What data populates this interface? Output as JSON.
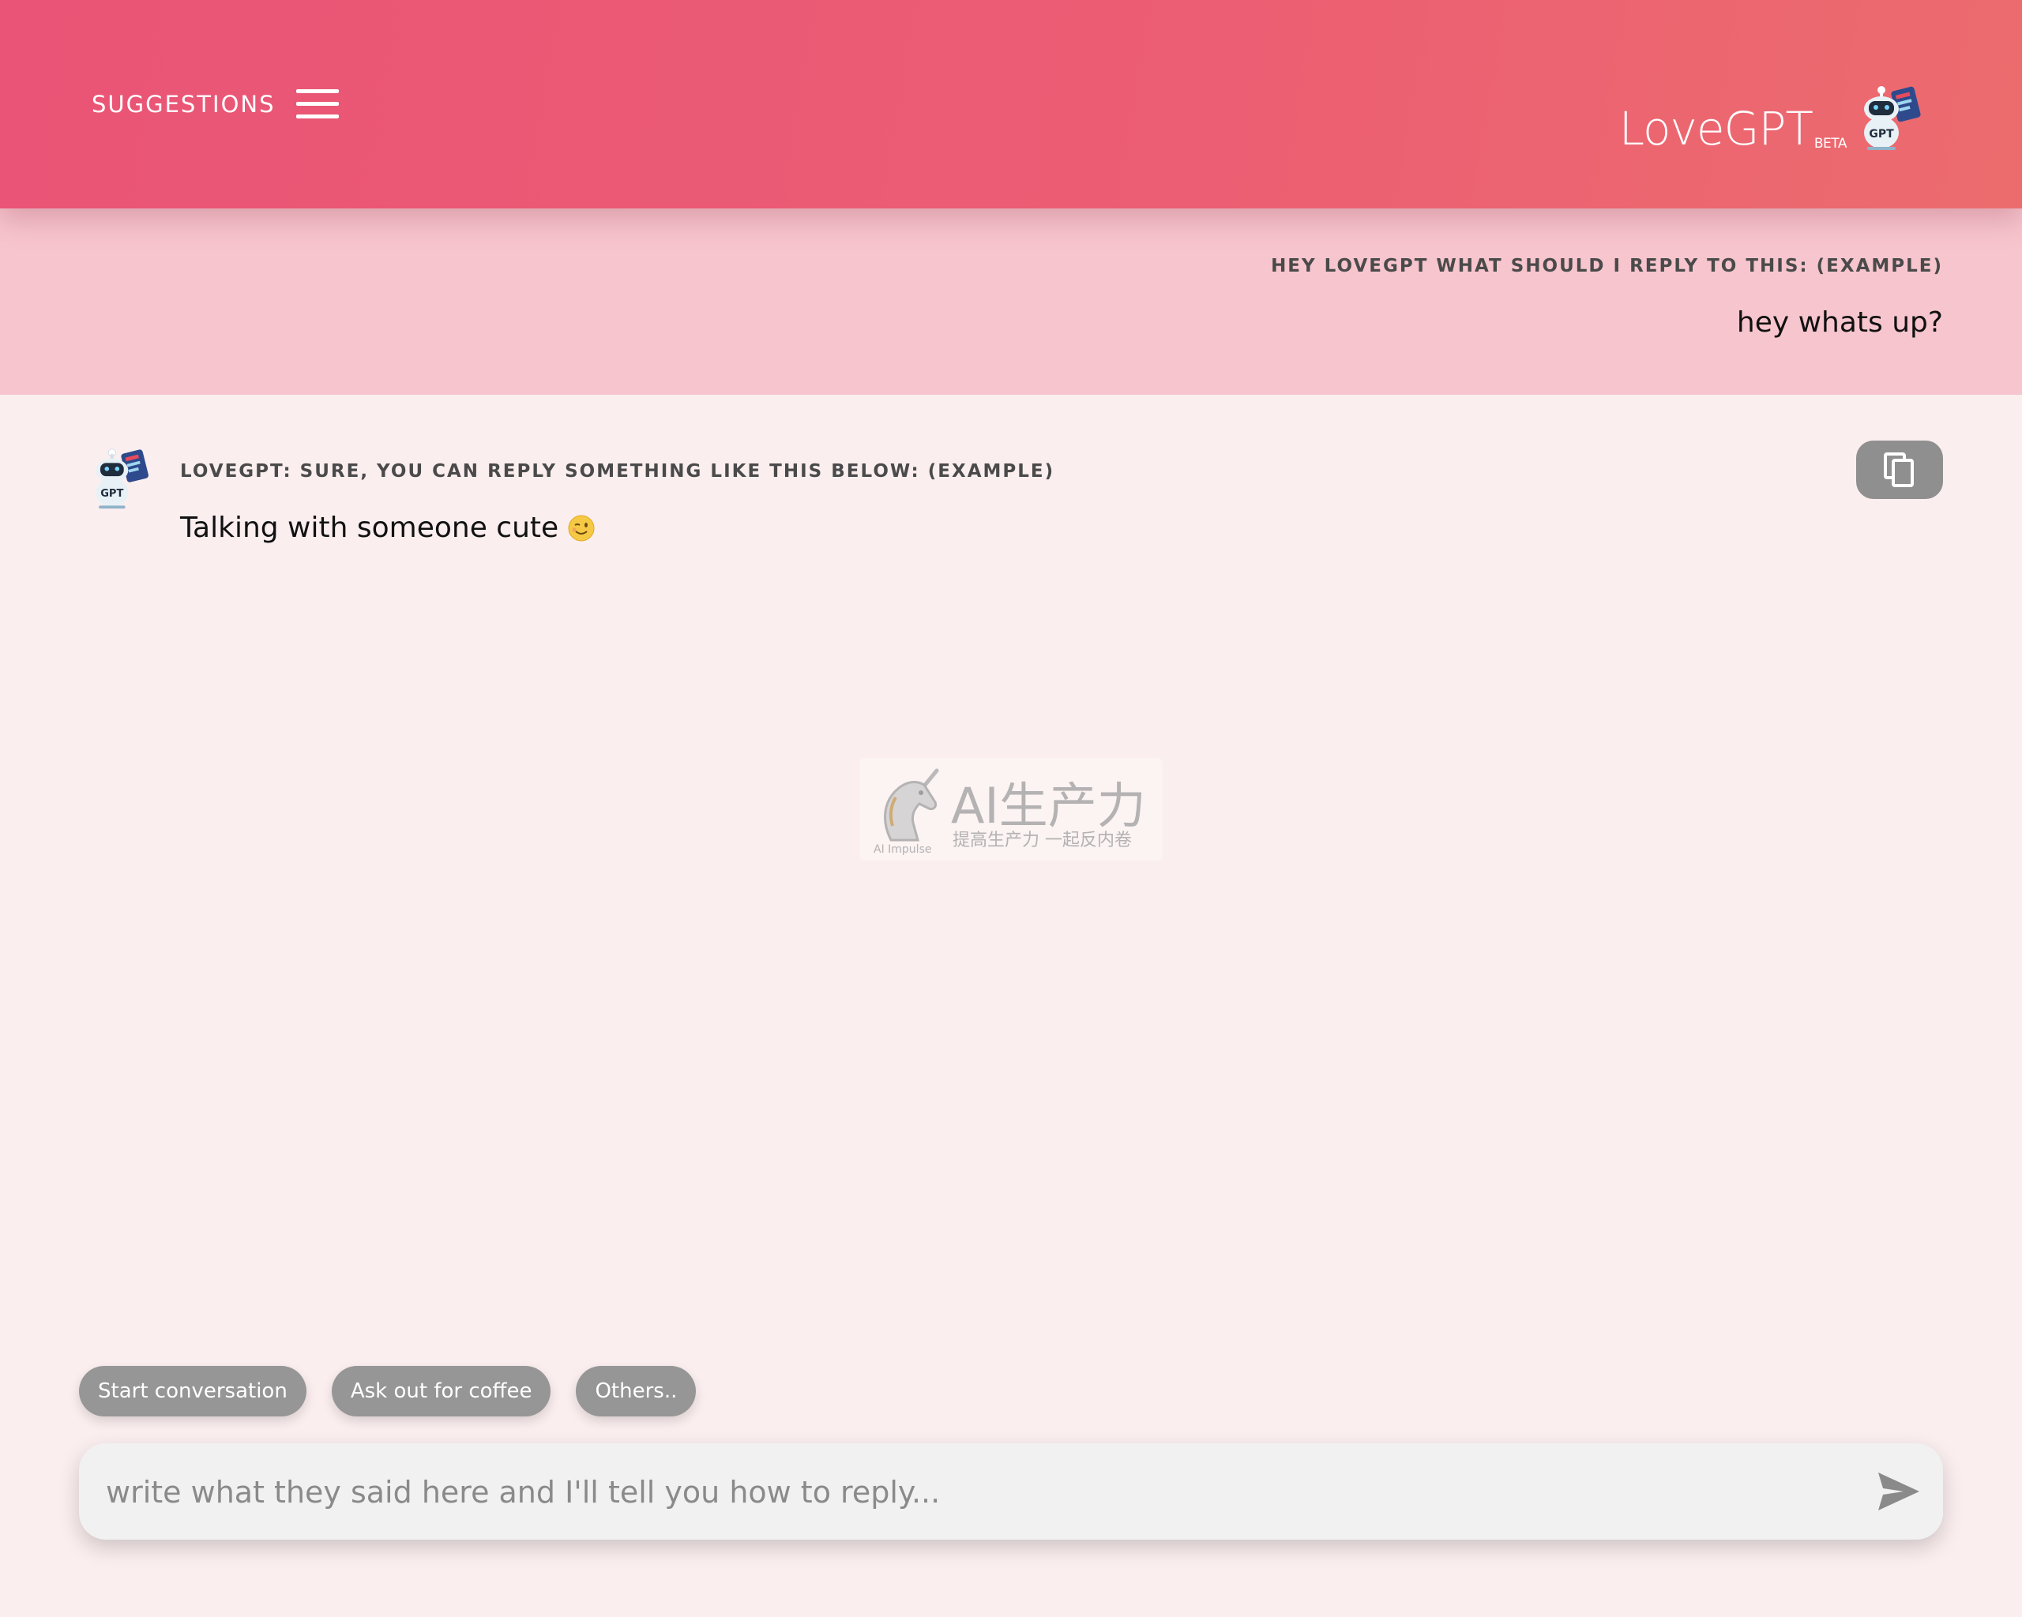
{
  "header": {
    "menu_label": "SUGGESTIONS",
    "brand_name": "LoveGPT",
    "brand_tag": "BETA",
    "robot_label": "GPT"
  },
  "conversation": {
    "user_heading": "HEY LOVEGPT WHAT SHOULD I REPLY TO THIS: (EXAMPLE)",
    "user_message": "hey whats up?",
    "bot_heading": "LOVEGPT: SURE, YOU CAN REPLY SOMETHING LIKE THIS BELOW: (EXAMPLE)",
    "bot_message": "Talking with someone cute",
    "bot_emoji": "wink-emoji-icon",
    "bot_avatar_label": "GPT"
  },
  "watermark": {
    "main": "AI生产力",
    "sub": "提高生产力 一起反内卷",
    "caption": "AI Impulse"
  },
  "suggestion_chips": [
    {
      "label": "Start conversation"
    },
    {
      "label": "Ask out for coffee"
    },
    {
      "label": "Others.."
    }
  ],
  "composer": {
    "placeholder": "write what they said here and I'll tell you how to reply..."
  },
  "colors": {
    "header": "#ea5476",
    "user_band": "#f7c5ce",
    "page": "#fbeeef",
    "chip": "#969696"
  }
}
